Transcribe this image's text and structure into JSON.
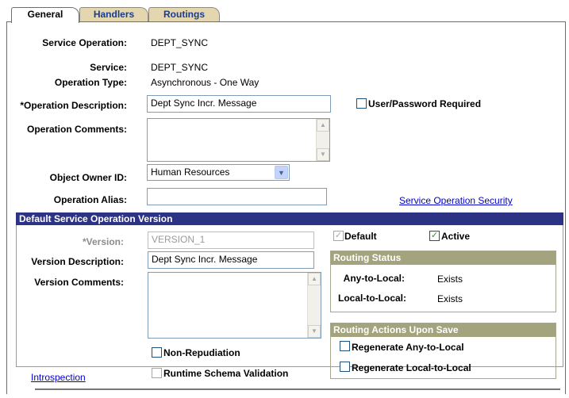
{
  "tabs": [
    {
      "label": "General",
      "active": true
    },
    {
      "label": "Handlers",
      "active": false
    },
    {
      "label": "Routings",
      "active": false
    }
  ],
  "general": {
    "service_operation_label": "Service Operation:",
    "service_operation_value": "DEPT_SYNC",
    "service_label": "Service:",
    "service_value": "DEPT_SYNC",
    "operation_type_label": "Operation Type:",
    "operation_type_value": "Asynchronous - One Way",
    "operation_description_label": "*Operation Description:",
    "operation_description_value": "Dept Sync Incr. Message",
    "user_password_label": "User/Password Required",
    "user_password_checked": false,
    "operation_comments_label": "Operation Comments:",
    "operation_comments_value": "",
    "object_owner_label": "Object Owner ID:",
    "object_owner_value": "Human Resources",
    "operation_alias_label": "Operation Alias:",
    "operation_alias_value": "",
    "security_link": "Service Operation Security"
  },
  "version": {
    "section_title": "Default Service Operation Version",
    "version_label": "*Version:",
    "version_value": "VERSION_1",
    "default_label": "Default",
    "default_checked": true,
    "active_label": "Active",
    "active_checked": true,
    "version_description_label": "Version Description:",
    "version_description_value": "Dept Sync Incr. Message",
    "version_comments_label": "Version Comments:",
    "version_comments_value": "",
    "non_repudiation_label": "Non-Repudiation",
    "non_repudiation_checked": false,
    "runtime_schema_label": "Runtime Schema Validation",
    "runtime_schema_checked": false,
    "introspection_link": "Introspection"
  },
  "routing_status": {
    "title": "Routing Status",
    "any_to_local_label": "Any-to-Local:",
    "any_to_local_value": "Exists",
    "local_to_local_label": "Local-to-Local:",
    "local_to_local_value": "Exists"
  },
  "routing_actions": {
    "title": "Routing Actions Upon Save",
    "regen_any_label": "Regenerate Any-to-Local",
    "regen_any_checked": false,
    "regen_local_label": "Regenerate Local-to-Local",
    "regen_local_checked": false
  },
  "colors": {
    "section_header": "#2c3384",
    "group_header": "#a3a37d",
    "link": "#0000cc",
    "check": "#21a121",
    "tab_inactive": "#e4d7b0"
  }
}
